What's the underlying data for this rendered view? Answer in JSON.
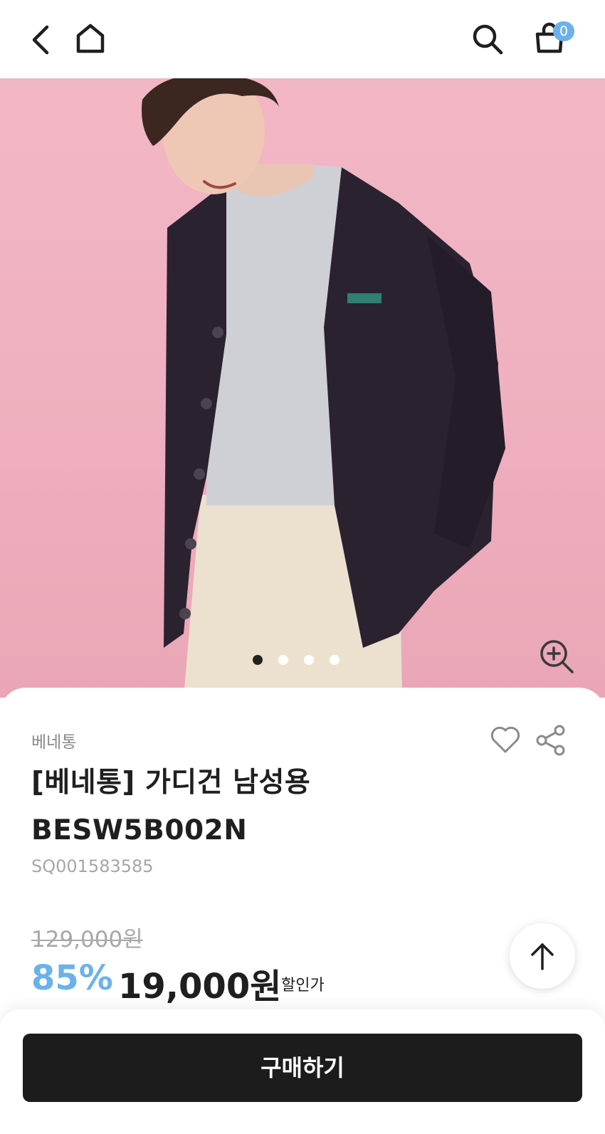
{
  "header": {
    "icons": [
      "back-icon",
      "home-icon",
      "search-icon",
      "cart-icon"
    ],
    "cart_count": "0"
  },
  "gallery": {
    "image": "product-photo",
    "slides": 4,
    "active_slide": 1,
    "zoom_icon": "zoom-in-icon"
  },
  "product": {
    "brand": "베네통",
    "title": "[베네통] 가디건 남성용 BESW5B002N",
    "code": "SQ001583585",
    "original_price": "129,000원",
    "discount": "85%",
    "sale_price": "19,000원",
    "sale_label": "할인가"
  },
  "actions": {
    "buy_label": "구매하기"
  },
  "colors": {
    "accent": "#6cb2ea",
    "button": "#1c1c1c",
    "background_photo": "#f2b7c5"
  }
}
